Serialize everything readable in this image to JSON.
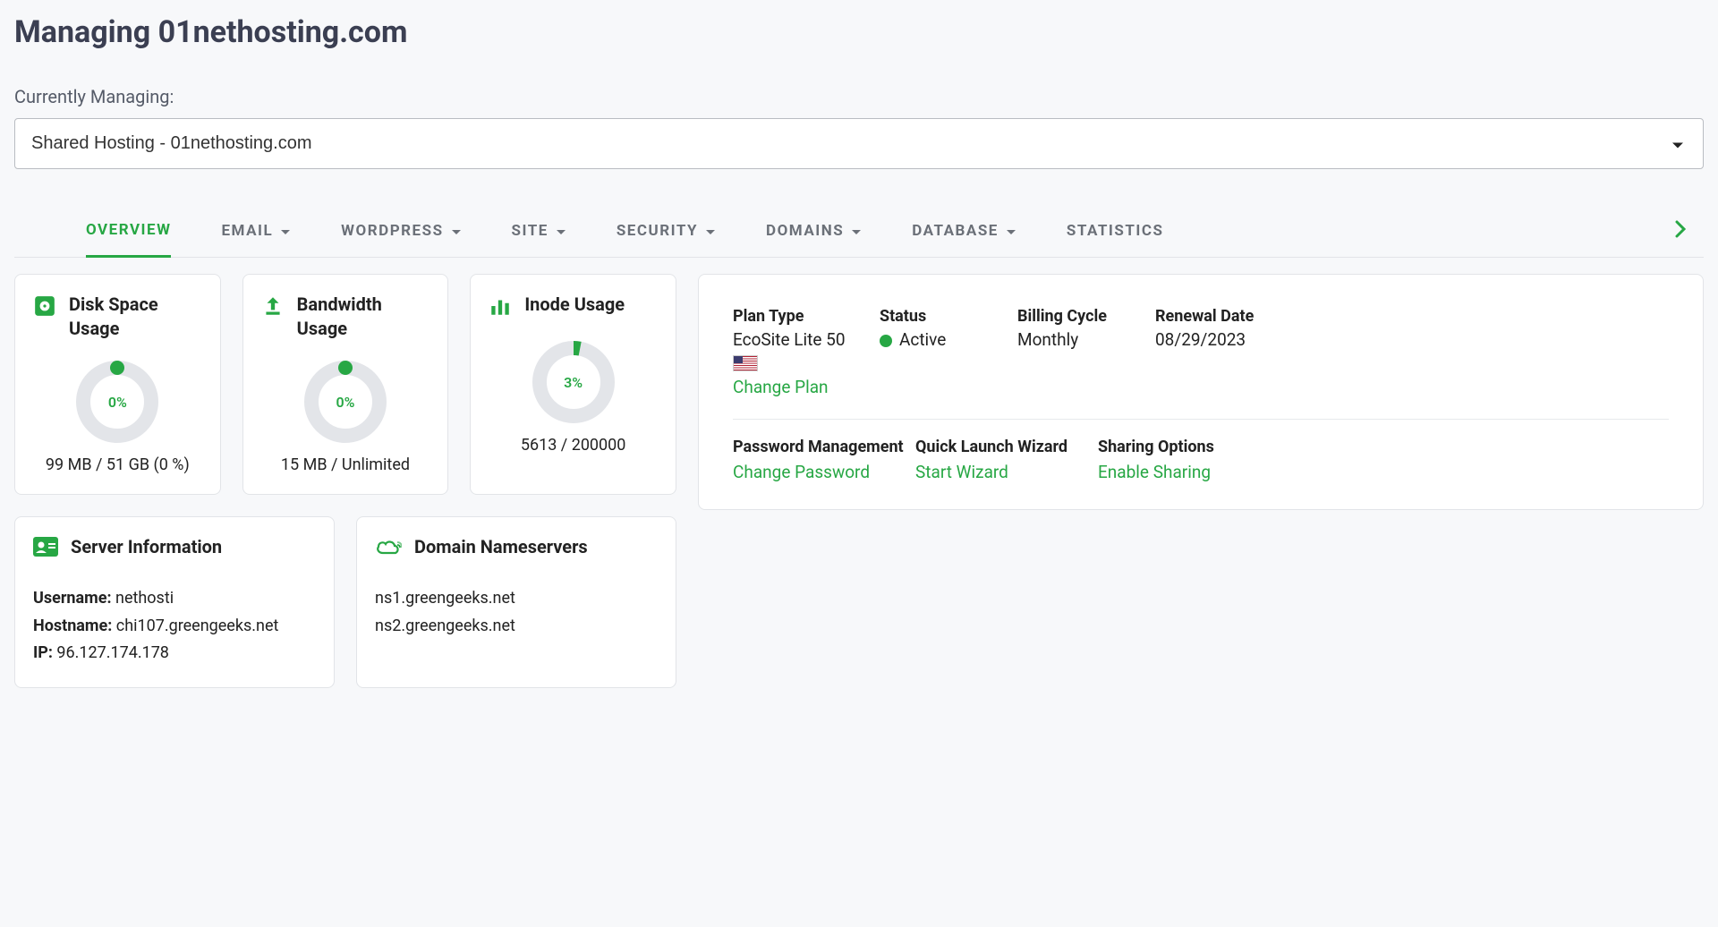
{
  "header": {
    "title": "Managing 01nethosting.com",
    "managing_label": "Currently Managing:",
    "selected_option": "Shared Hosting - 01nethosting.com"
  },
  "tabs": [
    {
      "label": "OVERVIEW",
      "has_caret": false,
      "active": true
    },
    {
      "label": "EMAIL",
      "has_caret": true,
      "active": false
    },
    {
      "label": "WORDPRESS",
      "has_caret": true,
      "active": false
    },
    {
      "label": "SITE",
      "has_caret": true,
      "active": false
    },
    {
      "label": "SECURITY",
      "has_caret": true,
      "active": false
    },
    {
      "label": "DOMAINS",
      "has_caret": true,
      "active": false
    },
    {
      "label": "DATABASE",
      "has_caret": true,
      "active": false
    },
    {
      "label": "STATISTICS",
      "has_caret": false,
      "active": false
    }
  ],
  "usage_cards": {
    "disk": {
      "title": "Disk Space Usage",
      "percent": 0,
      "percent_label": "0%",
      "detail": "99 MB / 51 GB (0 %)"
    },
    "bandwidth": {
      "title": "Bandwidth Usage",
      "percent": 0,
      "percent_label": "0%",
      "detail": "15 MB / Unlimited"
    },
    "inode": {
      "title": "Inode Usage",
      "percent": 3,
      "percent_label": "3%",
      "detail": "5613 / 200000"
    }
  },
  "plan": {
    "plan_type_label": "Plan Type",
    "plan_type_value": "EcoSite Lite 50",
    "change_plan": "Change Plan",
    "status_label": "Status",
    "status_value": "Active",
    "billing_label": "Billing Cycle",
    "billing_value": "Monthly",
    "renewal_label": "Renewal Date",
    "renewal_value": "08/29/2023",
    "pwmgmt_label": "Password Management",
    "pwmgmt_link": "Change Password",
    "wizard_label": "Quick Launch Wizard",
    "wizard_link": "Start Wizard",
    "sharing_label": "Sharing Options",
    "sharing_link": "Enable Sharing"
  },
  "server_info": {
    "title": "Server Information",
    "username_label": "Username:",
    "username_value": "nethosti",
    "hostname_label": "Hostname:",
    "hostname_value": "chi107.greengeeks.net",
    "ip_label": "IP:",
    "ip_value": "96.127.174.178"
  },
  "nameservers": {
    "title": "Domain Nameservers",
    "ns1": "ns1.greengeeks.net",
    "ns2": "ns2.greengeeks.net"
  },
  "colors": {
    "accent": "#27a744"
  }
}
